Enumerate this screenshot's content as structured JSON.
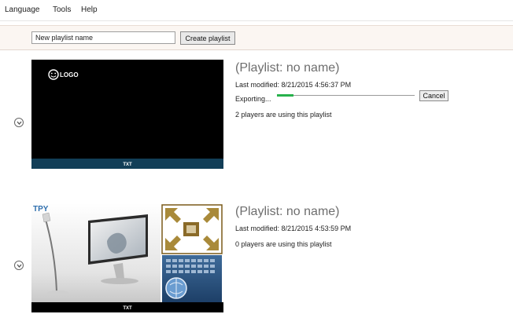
{
  "menu": {
    "items": [
      "Language",
      "Tools",
      "Help"
    ]
  },
  "toolbar": {
    "name_value": "New playlist name",
    "create_label": "Create playlist"
  },
  "playlists": [
    {
      "title": "(Playlist: no name)",
      "modified": "Last modified: 8/21/2015 4:56:37 PM",
      "status": "Exporting...",
      "progress": 0.12,
      "cancel_label": "Cancel",
      "players": "2 players are using this playlist",
      "thumb": {
        "logo_text": "LOGO",
        "footer_text": "TXT"
      }
    },
    {
      "title": "(Playlist: no name)",
      "modified": "Last modified: 8/21/2015 4:53:59 PM",
      "players": "0 players are using this playlist",
      "thumb": {
        "brand_text": "TPY",
        "footer_text": "TXT"
      }
    }
  ],
  "colors": {
    "progress": "#27b14b",
    "thumb_footer": "#123e57",
    "toolbar_bg": "#fbf6f2"
  },
  "icons": {
    "expand": "chevron-down-circle-icon",
    "move": "move-arrows-icon",
    "globe": "globe-icon"
  }
}
